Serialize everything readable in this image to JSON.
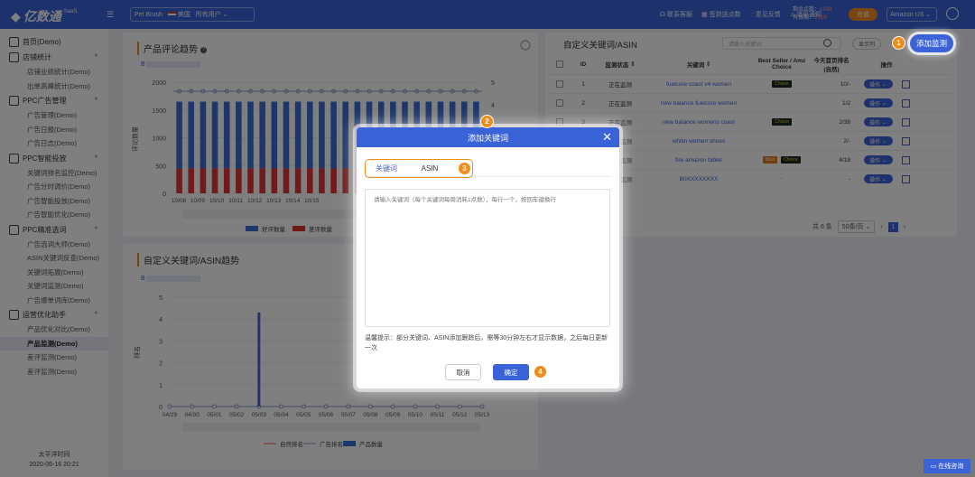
{
  "topbar": {
    "logo": "亿数通",
    "logo_sup": "SaaS",
    "store": "Pet Brush",
    "country": "美国",
    "users": "所有用户",
    "nav": [
      "联系客服",
      "签到送点数",
      "意见反馈",
      "消息通知"
    ],
    "points_label": "剩余点数：",
    "points_value": "1938",
    "valid_label": "有效期：",
    "valid_value": "2019-",
    "recharge": "充值",
    "marketplace": "Amazon US"
  },
  "sidebar": {
    "groups": [
      {
        "label": "首页(Demo)",
        "icon": "home-icon",
        "items": []
      },
      {
        "label": "店铺统计",
        "icon": "store-icon",
        "items": [
          "店铺业绩统计(Demo)",
          "出单高峰统计(Demo)"
        ]
      },
      {
        "label": "PPC广告管理",
        "icon": "ppc-icon",
        "items": [
          "广告管理(Demo)",
          "广告日报(Demo)",
          "广告日志(Demo)"
        ]
      },
      {
        "label": "PPC智能投放",
        "icon": "ai-icon",
        "items": [
          "关键词排名监控(Demo)",
          "广告分时调价(Demo)",
          "广告智能投放(Demo)",
          "广告智能优化(Demo)"
        ]
      },
      {
        "label": "PPC精准选词",
        "icon": "target-icon",
        "items": [
          "广告选词大师(Demo)",
          "ASIN关键词反查(Demo)",
          "关键词拓展(Demo)",
          "关键词监测(Demo)",
          "广告爆单词库(Demo)"
        ]
      },
      {
        "label": "运营优化助手",
        "icon": "ops-icon",
        "items": [
          "产品优化对比(Demo)",
          "产品监测(Demo)",
          "差评监测(Demo)",
          "差评监测(Demo)"
        ]
      }
    ],
    "active_item": "产品监测(Demo)",
    "timezone": "太平洋时间",
    "datetime": "2020-06-16 20:21"
  },
  "review_panel": {
    "title": "产品评论趋势",
    "legend": [
      "好评数量",
      "差评数量"
    ],
    "chart_data": {
      "type": "bar",
      "title": "产品评论趋势",
      "categories": [
        "10/08",
        "10/09",
        "10/10",
        "10/11",
        "10/12",
        "10/13",
        "10/14",
        "10/15"
      ],
      "series": [
        {
          "name": "好评数量",
          "values": [
            1200,
            1200,
            1200,
            1200,
            1200,
            1200,
            1200,
            1200
          ]
        },
        {
          "name": "差评数量",
          "values": [
            450,
            450,
            450,
            450,
            450,
            450,
            450,
            450
          ]
        }
      ],
      "ylabel": "评论数量",
      "ylim": [
        0,
        2000
      ],
      "y2lim": [
        0,
        5
      ],
      "yticks": [
        0,
        500,
        1000,
        1500,
        2000
      ],
      "y2ticks": [
        0,
        1,
        2,
        3,
        4,
        5
      ]
    }
  },
  "keyword_panel": {
    "title": "自定义关键词/ASIN趋势",
    "legend": [
      "自然排名",
      "广告排名",
      "产品数量"
    ],
    "chart_data": {
      "type": "bar",
      "categories": [
        "04/29",
        "04/30",
        "05/01",
        "05/02",
        "05/03",
        "05/04",
        "05/05",
        "05/06",
        "05/07",
        "05/08",
        "05/09",
        "05/10",
        "05/11",
        "05/12",
        "05/13"
      ],
      "series": [
        {
          "name": "产品数量",
          "values": [
            0,
            0,
            0,
            0,
            4.3,
            0,
            0,
            0,
            0,
            0,
            0,
            0,
            0,
            0,
            0
          ]
        }
      ],
      "ylabel": "排名",
      "ylim": [
        0,
        5
      ],
      "yticks": [
        0,
        1,
        2,
        3,
        4,
        5
      ]
    }
  },
  "table_panel": {
    "title": "自定义关键词/ASIN",
    "search_placeholder": "请输入关键词",
    "display_columns": "显示列",
    "add_button": "添加监测",
    "headers": [
      "ID",
      "监测状态",
      "关键词",
      "Best Seller / Amz Choice",
      "今天首页排名(自然)",
      "操作"
    ],
    "rows": [
      {
        "id": "1",
        "status": "正在监测",
        "keyword": "fuelcore coast v4 women",
        "tags": [
          "Choice"
        ],
        "rank": "10/-"
      },
      {
        "id": "2",
        "status": "正在监测",
        "keyword": "new balance fuelcore women",
        "tags": [],
        "rank": "1/2"
      },
      {
        "id": "3",
        "status": "正在监测",
        "keyword": "new balance womens coast",
        "tags": [
          "Choice"
        ],
        "rank": "2/38"
      },
      {
        "id": "4",
        "status": "正在监测",
        "keyword": "whitin women shoes",
        "tags": [],
        "rank": "2/-"
      },
      {
        "id": "5",
        "status": "正在监测",
        "keyword": "fire amazon tablet",
        "tags": [
          "Best",
          "Choice"
        ],
        "rank": "4/18"
      },
      {
        "id": "6",
        "status": "正在监测",
        "keyword": "B0XXXXXXXX",
        "tags": [
          "-"
        ],
        "rank": "-"
      }
    ],
    "op_label": "操作",
    "total": "共 6 条",
    "page_size": "50条/页",
    "page": "1"
  },
  "modal": {
    "title": "添加关键词",
    "tabs": [
      "关键词",
      "ASIN"
    ],
    "placeholder": "请输入关键词（每个关键词每周消耗1点数），每行一个，按回车键换行",
    "tip": "温馨提示：部分关键词、ASIN添加跟踪后，需等30分钟左右才显示数据，之后每日更新一次",
    "cancel": "取消",
    "confirm": "确定"
  },
  "badges": [
    "1",
    "2",
    "3",
    "4"
  ],
  "online": "在线咨询",
  "colors": {
    "primary": "#3a63d8",
    "accent": "#f08c1c",
    "good": "#3b6fd6",
    "bad": "#e03535"
  }
}
